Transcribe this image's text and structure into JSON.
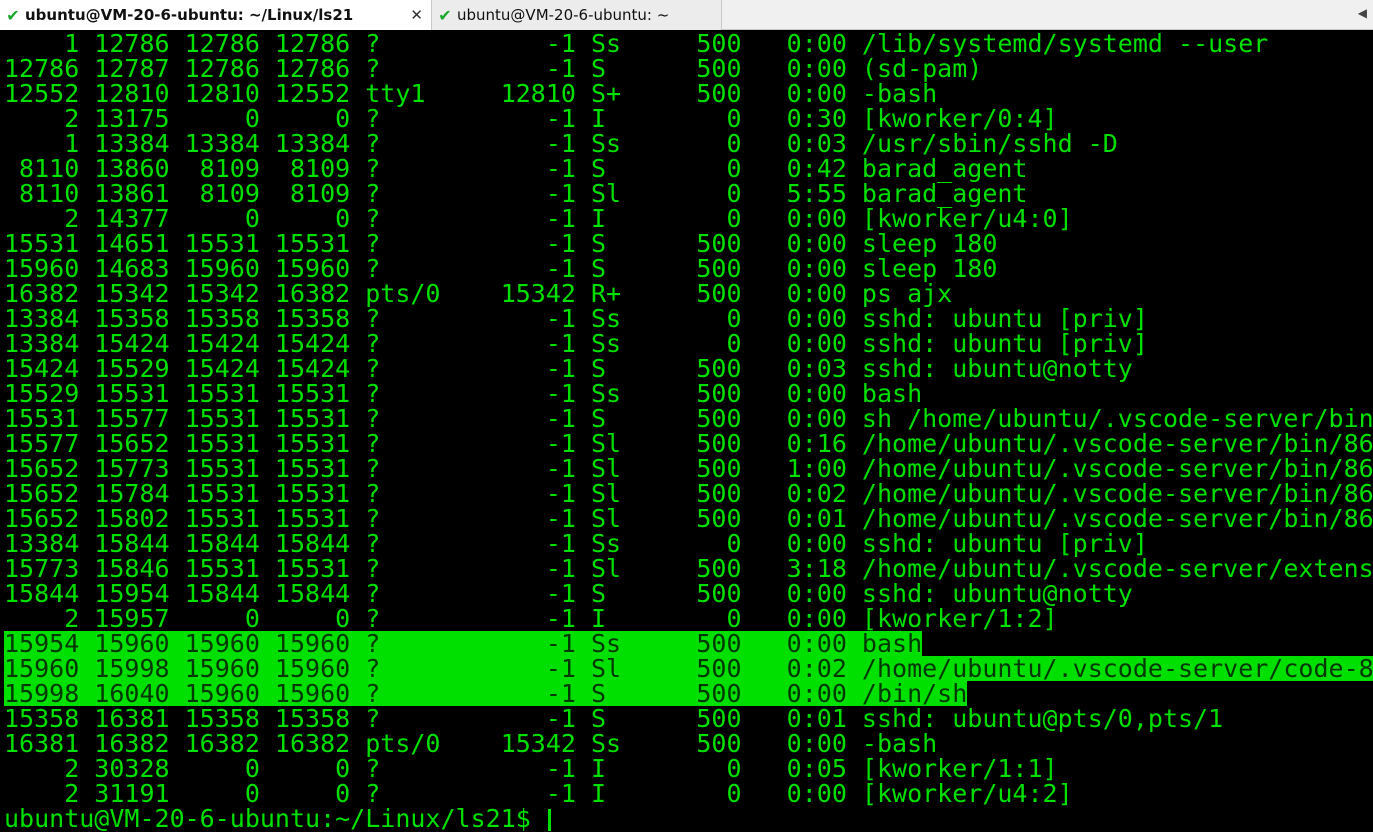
{
  "tabs": [
    {
      "label": "ubuntu@VM-20-6-ubuntu: ~/Linux/ls21",
      "active": true,
      "close": "✕"
    },
    {
      "label": "ubuntu@VM-20-6-ubuntu: ~",
      "active": false
    }
  ],
  "tab_nav_icon": "chevron-left-icon",
  "colors": {
    "terminal_bg": "#000000",
    "terminal_fg": "#00e000",
    "highlight_bg": "#00e000"
  },
  "terminal": {
    "lines": [
      "    1 12786 12786 12786 ?           -1 Ss     500   0:00 /lib/systemd/systemd --user",
      "12786 12787 12786 12786 ?           -1 S      500   0:00 (sd-pam)",
      "12552 12810 12810 12552 tty1     12810 S+     500   0:00 -bash",
      "    2 13175     0     0 ?           -1 I        0   0:30 [kworker/0:4]",
      "    1 13384 13384 13384 ?           -1 Ss       0   0:03 /usr/sbin/sshd -D",
      " 8110 13860  8109  8109 ?           -1 S        0   0:42 barad_agent",
      " 8110 13861  8109  8109 ?           -1 Sl       0   5:55 barad_agent",
      "    2 14377     0     0 ?           -1 I        0   0:00 [kworker/u4:0]",
      "15531 14651 15531 15531 ?           -1 S      500   0:00 sleep 180",
      "15960 14683 15960 15960 ?           -1 S      500   0:00 sleep 180",
      "16382 15342 15342 16382 pts/0    15342 R+     500   0:00 ps ajx",
      "13384 15358 15358 15358 ?           -1 Ss       0   0:00 sshd: ubuntu [priv]",
      "13384 15424 15424 15424 ?           -1 Ss       0   0:00 sshd: ubuntu [priv]",
      "15424 15529 15424 15424 ?           -1 S      500   0:03 sshd: ubuntu@notty",
      "15529 15531 15531 15531 ?           -1 Ss     500   0:00 bash",
      "15531 15577 15531 15531 ?           -1 S      500   0:00 sh /home/ubuntu/.vscode-server/bin",
      "15577 15652 15531 15531 ?           -1 Sl     500   0:16 /home/ubuntu/.vscode-server/bin/86",
      "15652 15773 15531 15531 ?           -1 Sl     500   1:00 /home/ubuntu/.vscode-server/bin/86",
      "15652 15784 15531 15531 ?           -1 Sl     500   0:02 /home/ubuntu/.vscode-server/bin/86",
      "15652 15802 15531 15531 ?           -1 Sl     500   0:01 /home/ubuntu/.vscode-server/bin/86",
      "13384 15844 15844 15844 ?           -1 Ss       0   0:00 sshd: ubuntu [priv]",
      "15773 15846 15531 15531 ?           -1 Sl     500   3:18 /home/ubuntu/.vscode-server/extens",
      "15844 15954 15844 15844 ?           -1 S      500   0:00 sshd: ubuntu@notty",
      "    2 15957     0     0 ?           -1 I        0   0:00 [kworker/1:2]",
      "15954 15960 15960 15960 ?           -1 Ss     500   0:00 bash",
      "15960 15998 15960 15960 ?           -1 Sl     500   0:02 /home/ubuntu/.vscode-server/code-8",
      "15998 16040 15960 15960 ?           -1 S      500   0:00 /bin/sh",
      "15358 16381 15358 15358 ?           -1 S      500   0:01 sshd: ubuntu@pts/0,pts/1",
      "16381 16382 16382 16382 pts/0    15342 Ss     500   0:00 -bash",
      "    2 30328     0     0 ?           -1 I        0   0:05 [kworker/1:1]",
      "    2 31191     0     0 ?           -1 I        0   0:00 [kworker/u4:2]"
    ],
    "highlighted_lines": [
      24,
      25,
      26
    ],
    "prompt": "ubuntu@VM-20-6-ubuntu:~/Linux/ls21$ "
  }
}
